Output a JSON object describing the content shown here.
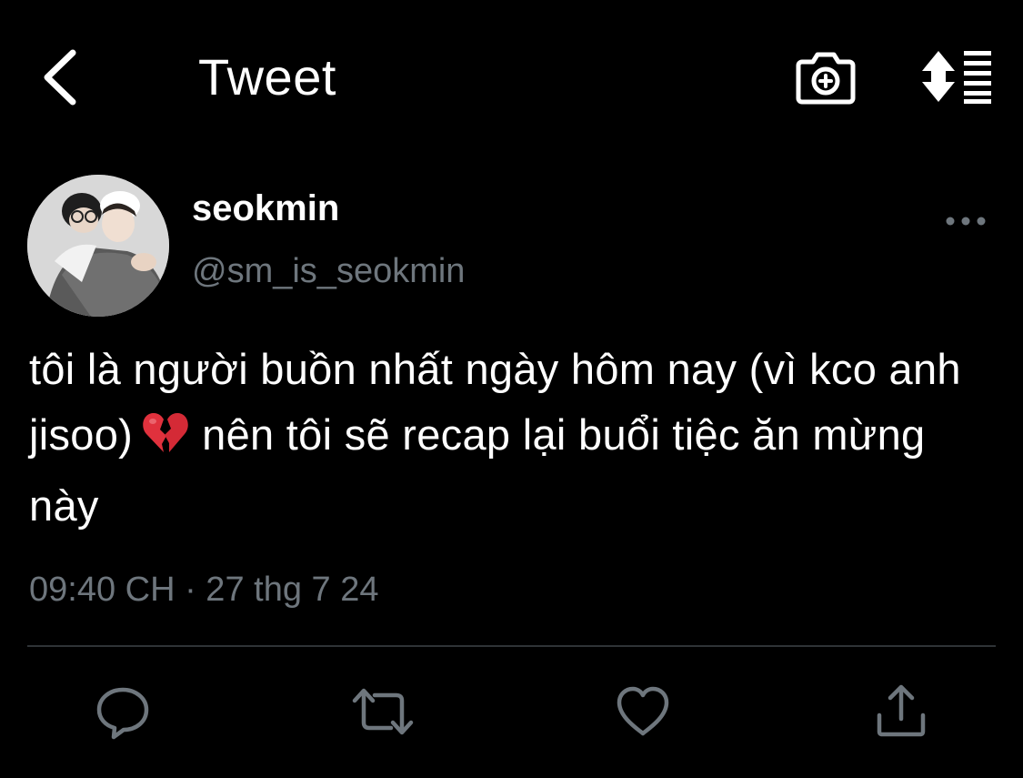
{
  "header": {
    "title": "Tweet",
    "back_icon": "chevron-left-icon",
    "camera_icon": "camera-plus-icon",
    "sort_icon": "sort-lines-icon"
  },
  "tweet": {
    "author": {
      "name": "seokmin",
      "handle": "@sm_is_seokmin"
    },
    "text_before_emoji": "tôi là người buồn nhất ngày hôm nay (vì kco anh jisoo)",
    "emoji": "broken-heart-icon",
    "text_after_emoji": "nên tôi sẽ recap lại buổi tiệc ăn mừng này",
    "timestamp": "09:40 CH · 27 thg 7 24"
  },
  "actions": {
    "reply_icon": "reply-icon",
    "retweet_icon": "retweet-icon",
    "like_icon": "heart-outline-icon",
    "share_icon": "share-icon"
  },
  "colors": {
    "background": "#000000",
    "text": "#ffffff",
    "secondary_text": "#6e767d",
    "divider": "#2f3336",
    "emoji": "#e0313d"
  }
}
